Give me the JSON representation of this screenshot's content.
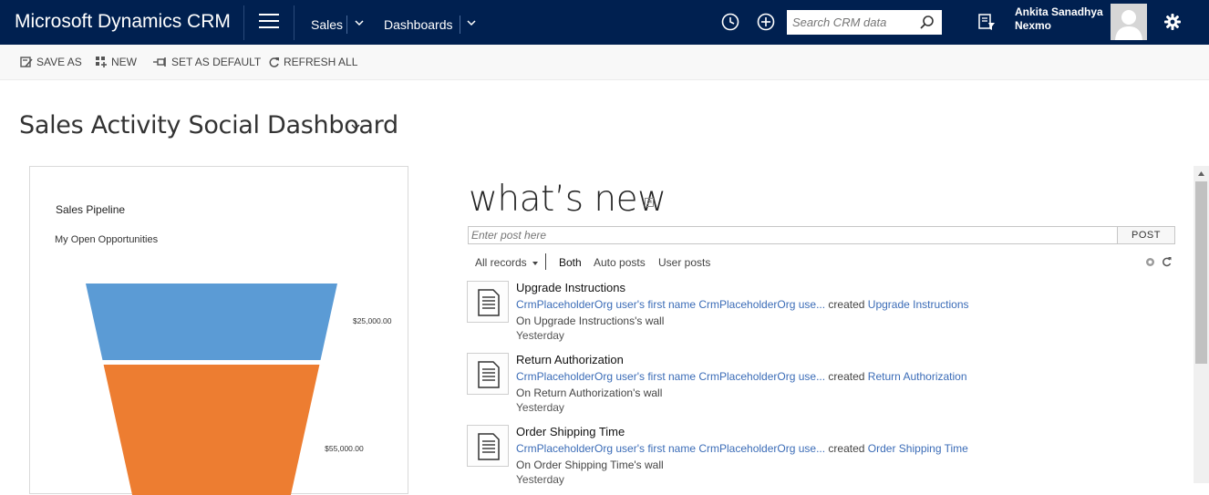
{
  "app": {
    "title": "Microsoft Dynamics CRM",
    "nav": [
      {
        "label": "Sales"
      },
      {
        "label": "Dashboards"
      }
    ],
    "search_placeholder": "Search CRM data",
    "user": {
      "name": "Ankita Sanadhya",
      "org": "Nexmo"
    },
    "icons": [
      "menu-icon",
      "history-icon",
      "plus-icon",
      "search-icon",
      "advanced-find-icon",
      "settings-icon"
    ],
    "colors": {
      "nav_bg": "#002050",
      "link": "#3b6cb7"
    }
  },
  "commands": [
    {
      "label": "SAVE AS",
      "icon": "save-as-icon"
    },
    {
      "label": "NEW",
      "icon": "new-icon"
    },
    {
      "label": "SET AS DEFAULT",
      "icon": "pin-icon"
    },
    {
      "label": "REFRESH ALL",
      "icon": "refresh-icon"
    }
  ],
  "dashboard": {
    "title": "Sales Activity Social Dashboard"
  },
  "chart": {
    "title": "Sales Pipeline",
    "view": "My Open Opportunities"
  },
  "chart_data": {
    "type": "funnel",
    "title": "Sales Pipeline",
    "subtitle": "My Open Opportunities",
    "series": [
      {
        "values": [
          25000,
          55000
        ],
        "labels": [
          "$25,000.00",
          "$55,000.00"
        ],
        "colors": [
          "#5b9bd5",
          "#ed7d31"
        ]
      }
    ]
  },
  "whats_new": {
    "title": "what’s new",
    "post_placeholder": "Enter post here",
    "post_button": "POST",
    "filters": {
      "records": "All records",
      "both": "Both",
      "auto": "Auto posts",
      "user": "User posts"
    },
    "posts": [
      {
        "title": "Upgrade Instructions",
        "author": "CrmPlaceholderOrg user's first name CrmPlaceholderOrg use...",
        "action": "created",
        "target": "Upgrade Instructions",
        "wall": "On Upgrade Instructions's wall",
        "time": "Yesterday"
      },
      {
        "title": "Return Authorization",
        "author": "CrmPlaceholderOrg user's first name CrmPlaceholderOrg use...",
        "action": "created",
        "target": "Return Authorization",
        "wall": "On Return Authorization's wall",
        "time": "Yesterday"
      },
      {
        "title": "Order Shipping Time",
        "author": "CrmPlaceholderOrg user's first name CrmPlaceholderOrg use...",
        "action": "created",
        "target": "Order Shipping Time",
        "wall": "On Order Shipping Time's wall",
        "time": "Yesterday"
      }
    ]
  }
}
